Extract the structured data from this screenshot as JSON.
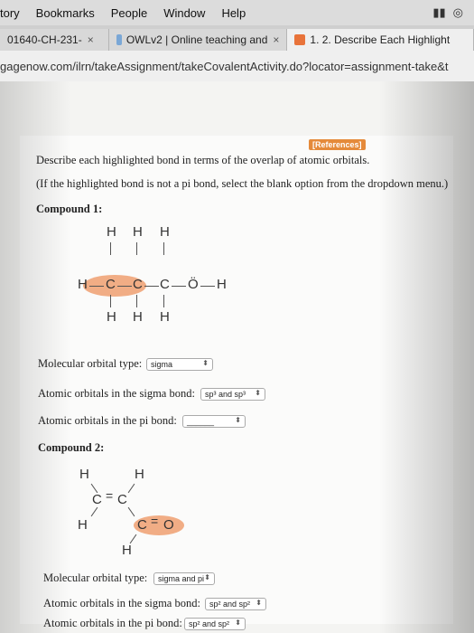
{
  "menubar": {
    "items": [
      "tory",
      "Bookmarks",
      "People",
      "Window",
      "Help"
    ]
  },
  "tabs": [
    {
      "label": "01640-CH-231-"
    },
    {
      "label": "OWLv2 | Online teaching and"
    },
    {
      "label": "1. 2. Describe Each Highlight"
    }
  ],
  "url": "gagenow.com/ilrn/takeAssignment/takeCovalentActivity.do?locator=assignment-take&t",
  "references": "[References]",
  "instructions": {
    "line1": "Describe each highlighted bond in terms of the overlap of atomic orbitals.",
    "line2": "(If the highlighted bond is not a pi bond, select the blank option from the dropdown menu.)"
  },
  "compound1": {
    "title": "Compound 1:",
    "mo_label": "Molecular orbital type:",
    "mo_value": "sigma",
    "sigma_label": "Atomic orbitals in the sigma bond:",
    "sigma_value": "sp³ and sp³",
    "pi_label": "Atomic orbitals in the pi bond:",
    "pi_value": "______"
  },
  "compound2": {
    "title": "Compound 2:",
    "mo_label": "Molecular orbital type:",
    "mo_value": "sigma and pi",
    "sigma_label": "Atomic orbitals in the sigma bond:",
    "sigma_value": "sp² and sp²",
    "pi_label": "Atomic orbitals in the pi bond:",
    "pi_value": "sp² and sp²"
  },
  "atoms": {
    "H": "H",
    "C": "C",
    "O": "O",
    "Odots": "Ö"
  },
  "colors": {
    "highlight": "#f0a478",
    "references_bg": "#e58a3a"
  }
}
